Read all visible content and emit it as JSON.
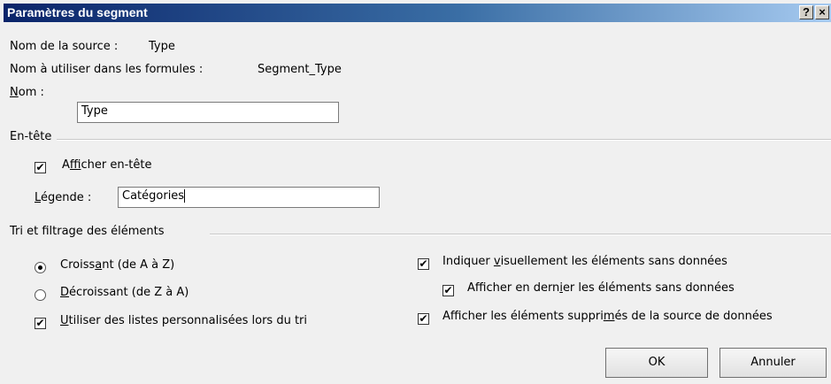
{
  "dialog": {
    "title": "Paramètres du segment",
    "help_button": "?",
    "close_button": "×"
  },
  "source": {
    "source_label": "Nom de la source :",
    "source_value": "Type",
    "formula_label": "Nom à utiliser dans les formules :",
    "formula_value": "Segment_Type",
    "name_label_u": "N",
    "name_label_rest": "om :",
    "name_value": "Type"
  },
  "header": {
    "group_label": "En-tête",
    "show_header_pre": "A",
    "show_header_u": "f",
    "show_header_post": "ficher en-tête",
    "show_header_checked": true,
    "caption_label_u": "L",
    "caption_label_rest": "égende :",
    "caption_value": "Catégories"
  },
  "sorting": {
    "group_label": "Tri et filtrage des éléments",
    "ascending_pre": "Croiss",
    "ascending_u": "a",
    "ascending_post": "nt (de A à Z)",
    "ascending_selected": true,
    "descending_u": "D",
    "descending_post": "écroissant (de Z à A)",
    "descending_selected": false,
    "custom_lists_u": "U",
    "custom_lists_post": "tiliser des listes personnalisées lors du tri",
    "custom_lists_checked": true,
    "indicate_pre": "Indiquer ",
    "indicate_u": "v",
    "indicate_post": "isuellement les éléments sans données",
    "indicate_checked": true,
    "last_pre": "Afficher en dern",
    "last_u": "i",
    "last_post": "er les éléments sans données",
    "last_checked": true,
    "deleted_pre": "Afficher les éléments suppri",
    "deleted_u": "m",
    "deleted_post": "és de la source de données",
    "deleted_checked": true
  },
  "buttons": {
    "ok": "OK",
    "cancel": "Annuler"
  },
  "icons": {
    "checkmark": "✔"
  }
}
